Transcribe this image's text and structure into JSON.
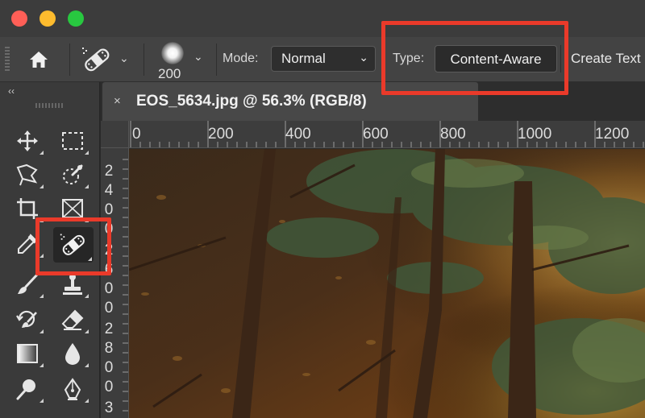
{
  "window": {
    "traffic_lights": [
      "#ff5f57",
      "#febc2e",
      "#28c840"
    ]
  },
  "options_bar": {
    "home_icon": "home-icon",
    "tool_preset_icon": "spot-healing-brush-icon",
    "brush_size": "200",
    "mode_label": "Mode:",
    "mode_value": "Normal",
    "type_label": "Type:",
    "type_active": "Content-Aware",
    "type_next": "Create Text"
  },
  "toolbox": {
    "collapse_label": "‹‹",
    "selected_tool": "spot-healing-brush"
  },
  "document": {
    "tab_close": "×",
    "tab_title": "EOS_5634.jpg @ 56.3% (RGB/8)"
  },
  "rulers": {
    "horizontal": [
      "0",
      "200",
      "400",
      "600",
      "800",
      "1000",
      "1200"
    ],
    "vertical": [
      [
        "2",
        "4",
        "0",
        "0"
      ],
      [
        "2",
        "6",
        "0",
        "0"
      ],
      [
        "2",
        "8",
        "0",
        "0"
      ],
      [
        "3"
      ]
    ]
  },
  "colors": {
    "highlight": "#ea3a2a",
    "panel": "#434343",
    "accent_text": "#ffffff"
  }
}
